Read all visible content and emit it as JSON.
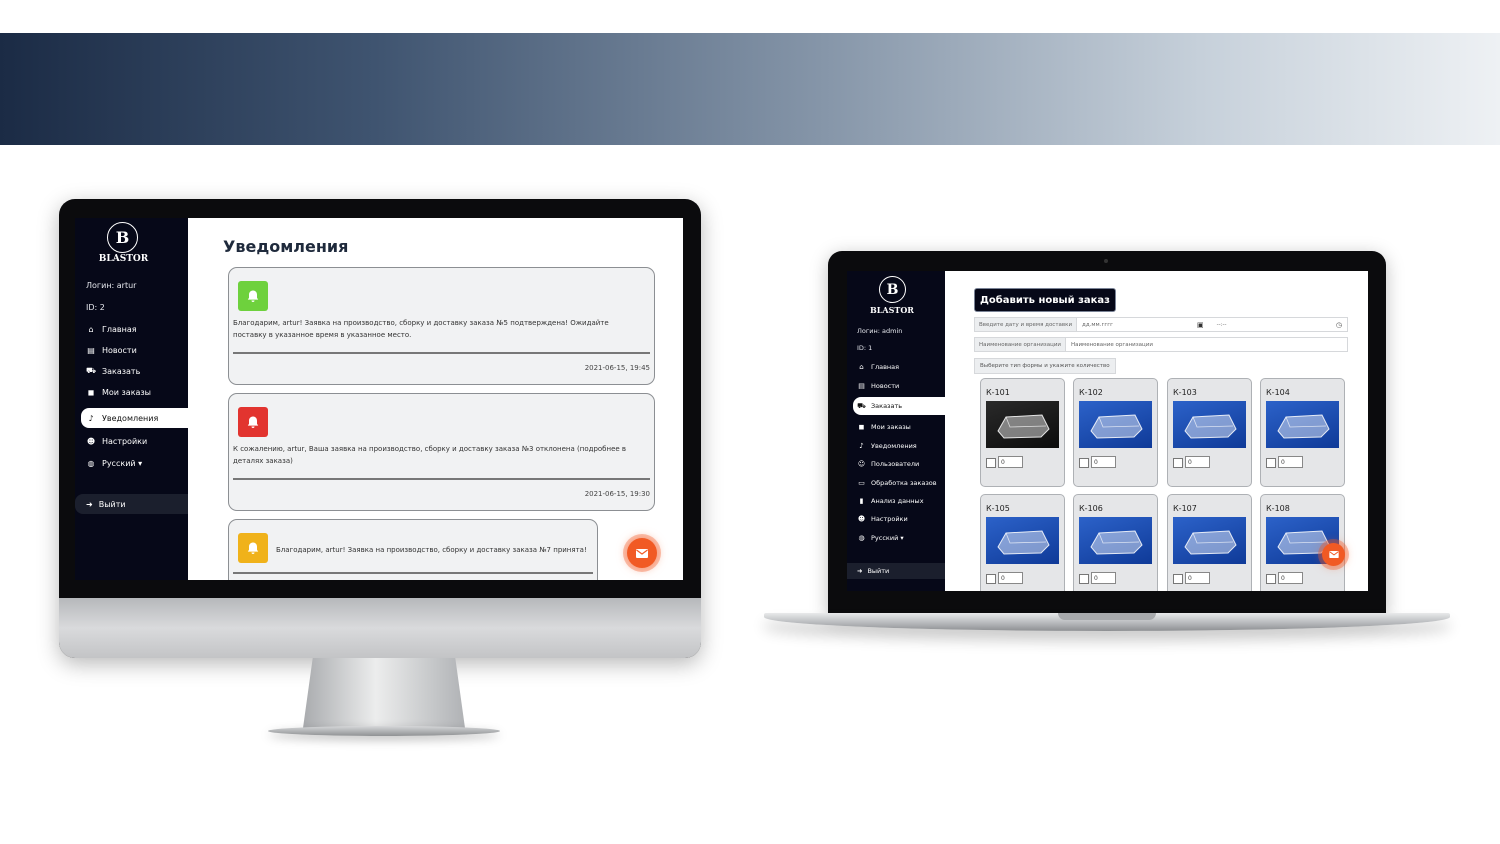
{
  "brand": {
    "letter": "B",
    "name": "BLASTOR"
  },
  "colors": {
    "sidebar": "#060818",
    "accent": "#f15a24",
    "success": "#6ed13d",
    "danger": "#e2342f",
    "warning": "#f0b21a"
  },
  "desktop": {
    "login": "Логин: artur",
    "id": "ID: 2",
    "nav": [
      {
        "label": "Главная",
        "icon": "home-icon"
      },
      {
        "label": "Новости",
        "icon": "newspaper-icon"
      },
      {
        "label": "Заказать",
        "icon": "cart-icon"
      },
      {
        "label": "Мои заказы",
        "icon": "bag-icon"
      },
      {
        "label": "Уведомления",
        "icon": "bell-icon",
        "active": true
      },
      {
        "label": "Настройки",
        "icon": "user-cog-icon"
      },
      {
        "label": "Русский ▾",
        "icon": "globe-icon"
      }
    ],
    "logout": "Выйти",
    "page_title": "Уведомления",
    "notifications": [
      {
        "status": "success",
        "message": "Благодарим, artur! Заявка на производство, сборку и доставку заказа №5 подтверждена! Ожидайте поставку в указанное время в указанное место.",
        "date": "2021-06-15, 19:45"
      },
      {
        "status": "danger",
        "message": "К сожалению, artur, Ваша заявка на производство, сборку и доставку заказа №3 отклонена (подробнее в деталях заказа)",
        "date": "2021-06-15, 19:30"
      },
      {
        "status": "warning",
        "message": "Благодарим, artur! Заявка на производство, сборку и доставку заказа №7 принята!",
        "date": ""
      }
    ]
  },
  "laptop": {
    "login": "Логин: admin",
    "id": "ID: 1",
    "nav": [
      {
        "label": "Главная",
        "icon": "home-icon"
      },
      {
        "label": "Новости",
        "icon": "newspaper-icon"
      },
      {
        "label": "Заказать",
        "icon": "cart-icon",
        "active": true
      },
      {
        "label": "Мои заказы",
        "icon": "bag-icon"
      },
      {
        "label": "Уведомления",
        "icon": "bell-icon"
      },
      {
        "label": "Пользователи",
        "icon": "users-icon"
      },
      {
        "label": "Обработка заказов",
        "icon": "inbox-icon"
      },
      {
        "label": "Анализ данных",
        "icon": "chart-icon"
      },
      {
        "label": "Настройки",
        "icon": "user-cog-icon"
      },
      {
        "label": "Русский ▾",
        "icon": "globe-icon"
      }
    ],
    "logout": "Выйти",
    "add_order_title": "Добавить новый заказ",
    "date_label": "Введите дату и время доставки",
    "date_placeholder": "дд.мм.гггг",
    "time_placeholder": "--:--",
    "org_label": "Наименование организации",
    "org_placeholder": "Наименование организации",
    "pick_hint": "Выберите тип формы и укажите количество",
    "products": [
      {
        "name": "К-101",
        "qty": "0"
      },
      {
        "name": "К-102",
        "qty": "0"
      },
      {
        "name": "К-103",
        "qty": "0"
      },
      {
        "name": "К-104",
        "qty": "0"
      },
      {
        "name": "К-105",
        "qty": "0"
      },
      {
        "name": "К-106",
        "qty": "0"
      },
      {
        "name": "К-107",
        "qty": "0"
      },
      {
        "name": "К-108",
        "qty": "0"
      }
    ]
  }
}
